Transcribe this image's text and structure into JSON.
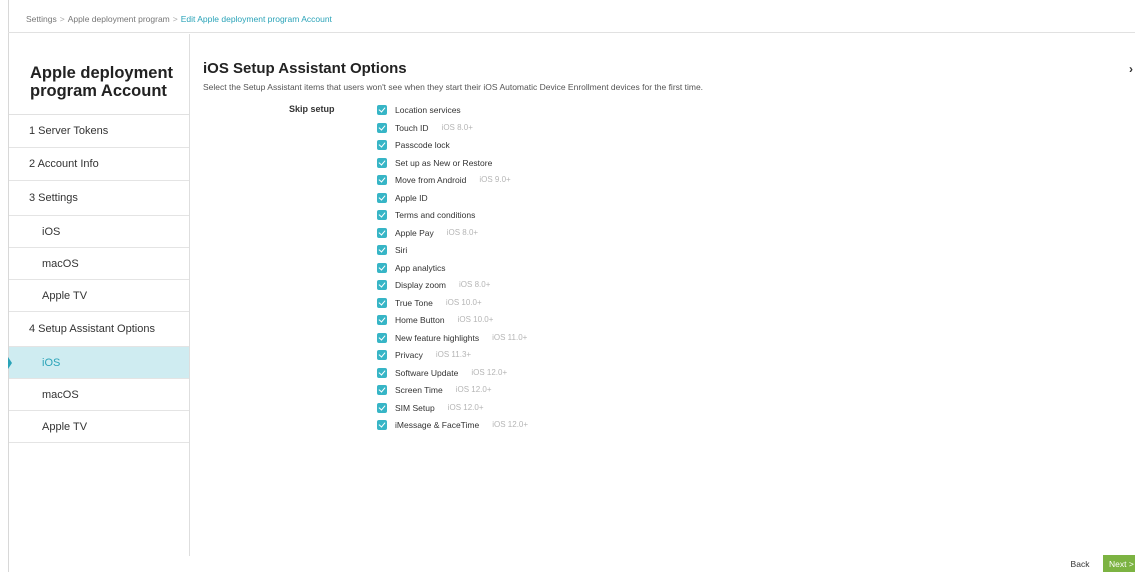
{
  "breadcrumb": {
    "items": [
      "Settings",
      "Apple deployment program"
    ],
    "separator": ">",
    "current": "Edit Apple deployment program Account"
  },
  "sidebar": {
    "title": "Apple deployment program Account",
    "items": [
      {
        "label": "1 Server Tokens"
      },
      {
        "label": "2 Account Info"
      },
      {
        "label": "3 Settings"
      },
      {
        "label": "iOS"
      },
      {
        "label": "macOS"
      },
      {
        "label": "Apple TV"
      },
      {
        "label": "4 Setup Assistant Options"
      },
      {
        "label": "iOS"
      },
      {
        "label": "macOS"
      },
      {
        "label": "Apple TV"
      }
    ]
  },
  "main": {
    "title": "iOS Setup Assistant Options",
    "description": "Select the Setup Assistant items that users won't see when they start their iOS Automatic Device Enrollment devices for the first time.",
    "skip_label": "Skip setup",
    "options": [
      {
        "label": "Location services",
        "version": "",
        "checked": true
      },
      {
        "label": "Touch ID",
        "version": "iOS 8.0+",
        "checked": true
      },
      {
        "label": "Passcode lock",
        "version": "",
        "checked": true
      },
      {
        "label": "Set up as New or Restore",
        "version": "",
        "checked": true
      },
      {
        "label": "Move from Android",
        "version": "iOS 9.0+",
        "checked": true
      },
      {
        "label": "Apple ID",
        "version": "",
        "checked": true
      },
      {
        "label": "Terms and conditions",
        "version": "",
        "checked": true
      },
      {
        "label": "Apple Pay",
        "version": "iOS 8.0+",
        "checked": true
      },
      {
        "label": "Siri",
        "version": "",
        "checked": true
      },
      {
        "label": "App analytics",
        "version": "",
        "checked": true
      },
      {
        "label": "Display zoom",
        "version": "iOS 8.0+",
        "checked": true
      },
      {
        "label": "True Tone",
        "version": "iOS 10.0+",
        "checked": true
      },
      {
        "label": "Home Button",
        "version": "iOS 10.0+",
        "checked": true
      },
      {
        "label": "New feature highlights",
        "version": "iOS 11.0+",
        "checked": true
      },
      {
        "label": "Privacy",
        "version": "iOS 11.3+",
        "checked": true
      },
      {
        "label": "Software Update",
        "version": "iOS 12.0+",
        "checked": true
      },
      {
        "label": "Screen Time",
        "version": "iOS 12.0+",
        "checked": true
      },
      {
        "label": "SIM Setup",
        "version": "iOS 12.0+",
        "checked": true
      },
      {
        "label": "iMessage & FaceTime",
        "version": "iOS 12.0+",
        "checked": true
      }
    ]
  },
  "footer": {
    "back_label": "Back",
    "next_label": "Next >"
  },
  "icons": {
    "collapse": "chevron-right-icon",
    "checkbox": "checkbox-checked-icon"
  },
  "colors": {
    "accent": "#2aa3b8",
    "checkbox": "#37b5c6",
    "active_bg": "#cfecf1",
    "next_button": "#7cb342"
  }
}
